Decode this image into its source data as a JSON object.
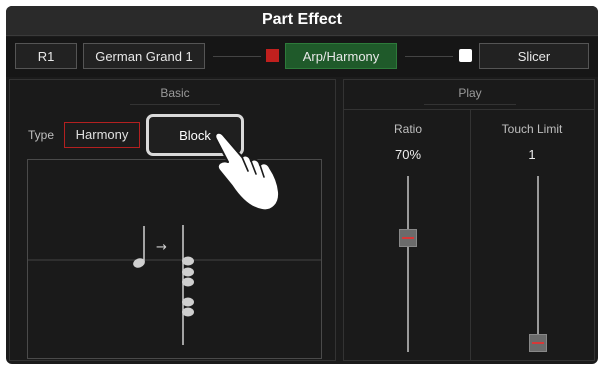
{
  "header": {
    "title": "Part Effect"
  },
  "part_row": {
    "part": "R1",
    "voice": "German Grand 1",
    "arp_harmony_label": "Arp/Harmony",
    "arp_harmony_indicator_color": "#c0201e",
    "slicer_label": "Slicer",
    "slicer_indicator_color": "#ffffff"
  },
  "basic": {
    "section_title": "Basic",
    "type_label": "Type",
    "options": [
      "Harmony",
      "Block"
    ],
    "selected": "Block",
    "preview_arrow": "→"
  },
  "play": {
    "section_title": "Play",
    "columns": [
      {
        "label": "Ratio",
        "value": "70%",
        "level": 0.7
      },
      {
        "label": "Touch Limit",
        "value": "1",
        "level": 0.0
      }
    ]
  },
  "colors": {
    "accent_green": "#1f5a2a",
    "harmony_border": "#b32020",
    "block_highlight": "#d9d9d9"
  },
  "icons": [
    "hand-pointer-icon"
  ]
}
